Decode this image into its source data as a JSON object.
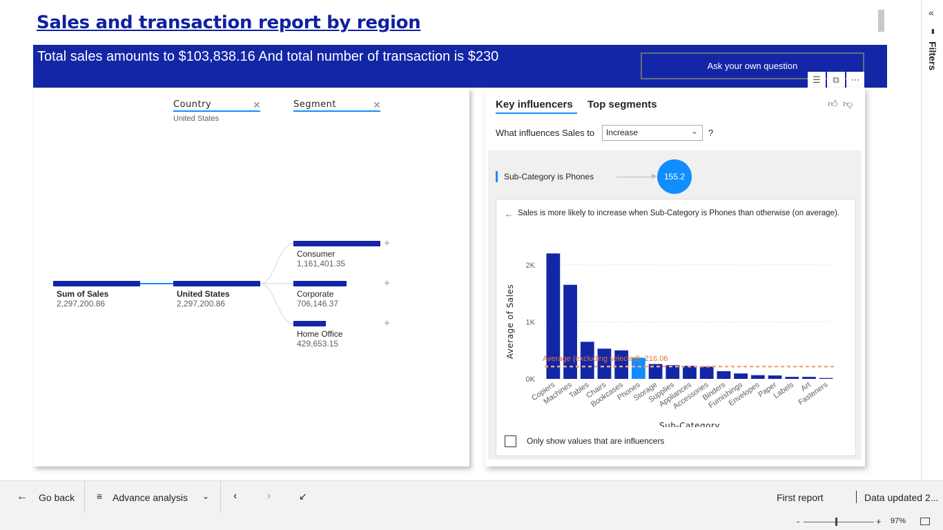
{
  "report": {
    "title": "Sales and transaction report by region",
    "banner_text": "Total sales amounts to $103,838.16 And total number of transaction is $230",
    "ask_button": "Ask your own question"
  },
  "decomposition": {
    "filters": [
      {
        "label": "Country",
        "selected": "United States"
      },
      {
        "label": "Segment",
        "selected": ""
      }
    ],
    "root": {
      "label": "Sum of Sales",
      "value": "2,297,200.86"
    },
    "level1": {
      "label": "United States",
      "value": "2,297,200.86"
    },
    "segments": [
      {
        "label": "Consumer",
        "value": "1,161,401.35",
        "fraction": 1.0
      },
      {
        "label": "Corporate",
        "value": "706,146.37",
        "fraction": 0.608
      },
      {
        "label": "Home Office",
        "value": "429,653.15",
        "fraction": 0.37
      }
    ]
  },
  "key_influencers": {
    "tabs": [
      "Key influencers",
      "Top segments"
    ],
    "question_prefix": "What influences Sales to",
    "dropdown_value": "Increase",
    "question_suffix": "?",
    "influencer_label": "Sub-Category is Phones",
    "influencer_value": "155.2",
    "explanation": "Sales is more likely to increase when Sub-Category is Phones than otherwise (on average).",
    "checkbox_label": "Only show values that are influencers"
  },
  "chart_data": {
    "type": "bar",
    "categories": [
      "Copiers",
      "Machines",
      "Tables",
      "Chairs",
      "Bookcases",
      "Phones",
      "Storage",
      "Supplies",
      "Appliances",
      "Accessories",
      "Binders",
      "Furnishings",
      "Envelopes",
      "Paper",
      "Labels",
      "Art",
      "Fasteners"
    ],
    "values": [
      2200,
      1650,
      650,
      530,
      500,
      370,
      260,
      240,
      230,
      215,
      135,
      95,
      65,
      60,
      35,
      35,
      15
    ],
    "highlighted": "Phones",
    "colors": {
      "bar": "#1226a6",
      "highlight": "#118dff",
      "reference": "#f4a582"
    },
    "reference_line": {
      "value": 216.06,
      "label": "Average (excluding selected): 216.06"
    },
    "xlabel": "Sub-Category",
    "ylabel": "Average of Sales",
    "yticks": [
      {
        "value": 0,
        "label": "0K"
      },
      {
        "value": 1000,
        "label": "1K"
      },
      {
        "value": 2000,
        "label": "2K"
      }
    ],
    "ylim": [
      0,
      2300
    ]
  },
  "filters_pane": {
    "label": "Filters"
  },
  "bottom_bar": {
    "go_back": "Go back",
    "advance_analysis": "Advance analysis",
    "first_report": "First report",
    "data_updated": "Data updated 2..."
  },
  "status": {
    "zoom": "97%"
  }
}
